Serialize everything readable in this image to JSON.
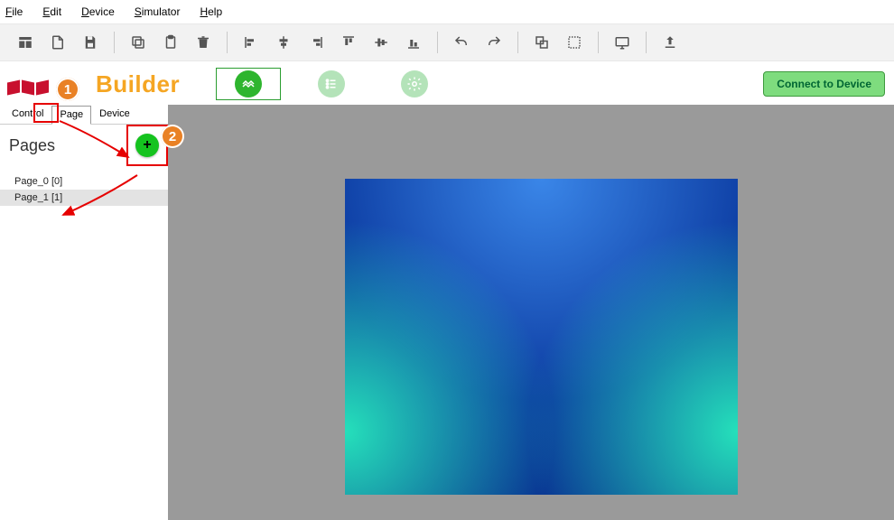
{
  "menubar": {
    "file": "File",
    "edit": "Edit",
    "device": "Device",
    "simulator": "Simulator",
    "help": "Help"
  },
  "toolbar_icons": {
    "insert_table": "insert-table",
    "new_file": "new-file",
    "save": "save",
    "copy": "copy",
    "paste": "paste",
    "delete": "delete",
    "align_left": "align-left",
    "align_center_h": "align-center-horizontal",
    "align_right": "align-right",
    "align_top": "align-top",
    "align_center_v": "align-center-vertical",
    "align_bottom": "align-bottom",
    "undo": "undo",
    "redo": "redo",
    "group1": "bring-forward",
    "group2": "select-area",
    "preview": "preview-screen",
    "upload": "upload"
  },
  "header": {
    "app_title": "Builder",
    "connect_label": "Connect to Device",
    "modes": {
      "design": "design-mode",
      "list": "list-mode",
      "settings": "settings-mode"
    }
  },
  "sidebar": {
    "tabs": [
      "Control",
      "Page",
      "Device"
    ],
    "active_tab_index": 1,
    "title": "Pages",
    "add_label": "+",
    "pages": [
      {
        "label": "Page_0 [0]",
        "selected": false
      },
      {
        "label": "Page_1 [1]",
        "selected": true
      }
    ]
  },
  "annotations": {
    "callout1": "1",
    "callout2": "2"
  }
}
